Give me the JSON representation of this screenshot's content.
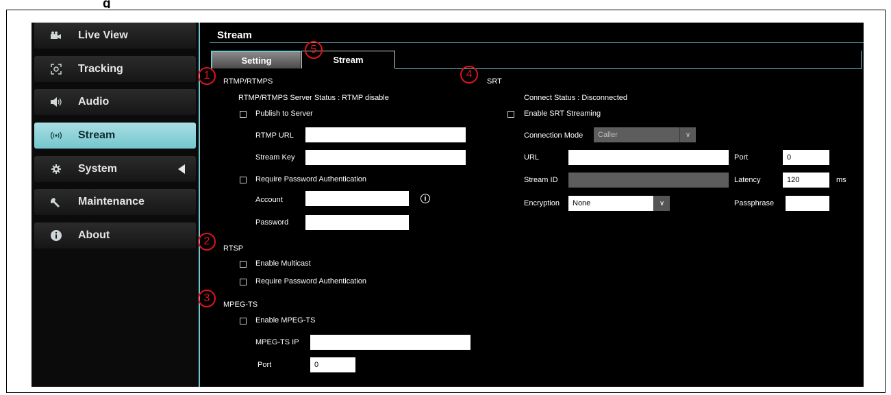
{
  "heading_fragment": "g",
  "sidebar": {
    "items": [
      {
        "label": "Live View",
        "icon": "camera-icon",
        "active": false
      },
      {
        "label": "Tracking",
        "icon": "tracking-icon",
        "active": false
      },
      {
        "label": "Audio",
        "icon": "speaker-icon",
        "active": false
      },
      {
        "label": "Stream",
        "icon": "broadcast-icon",
        "active": true
      },
      {
        "label": "System",
        "icon": "gear-icon",
        "active": false
      },
      {
        "label": "Maintenance",
        "icon": "wrench-icon",
        "active": false
      },
      {
        "label": "About",
        "icon": "info-icon",
        "active": false
      }
    ]
  },
  "page": {
    "title": "Stream",
    "tabs": [
      {
        "label": "Setting",
        "active": true
      },
      {
        "label": "Stream",
        "active": false
      }
    ]
  },
  "markers": [
    "1",
    "2",
    "3",
    "4",
    "5"
  ],
  "rtmp": {
    "heading": "RTMP/RTMPS",
    "status": "RTMP/RTMPS Server Status : RTMP disable",
    "publish_label": "Publish to Server",
    "url_label": "RTMP URL",
    "url_value": "",
    "key_label": "Stream Key",
    "key_value": "",
    "auth_label": "Require Password Authentication",
    "account_label": "Account",
    "account_value": "",
    "password_label": "Password",
    "password_value": ""
  },
  "rtsp": {
    "heading": "RTSP",
    "multicast_label": "Enable Multicast",
    "auth_label": "Require Password Authentication"
  },
  "mpegts": {
    "heading": "MPEG-TS",
    "enable_label": "Enable MPEG-TS",
    "ip_label": "MPEG-TS IP",
    "ip_value": "",
    "port_label": "Port",
    "port_value": "0"
  },
  "srt": {
    "heading": "SRT",
    "status": "Connect Status : Disconnected",
    "enable_label": "Enable SRT Streaming",
    "mode_label": "Connection Mode",
    "mode_value": "Caller",
    "url_label": "URL",
    "url_value": "",
    "port_label": "Port",
    "port_value": "0",
    "streamid_label": "Stream ID",
    "streamid_value": "",
    "latency_label": "Latency",
    "latency_value": "120",
    "latency_unit": "ms",
    "encryption_label": "Encryption",
    "encryption_value": "None",
    "passphrase_label": "Passphrase",
    "passphrase_value": ""
  },
  "colors": {
    "accent": "#6fc5cd",
    "marker": "#e0141c",
    "background": "#000000"
  }
}
